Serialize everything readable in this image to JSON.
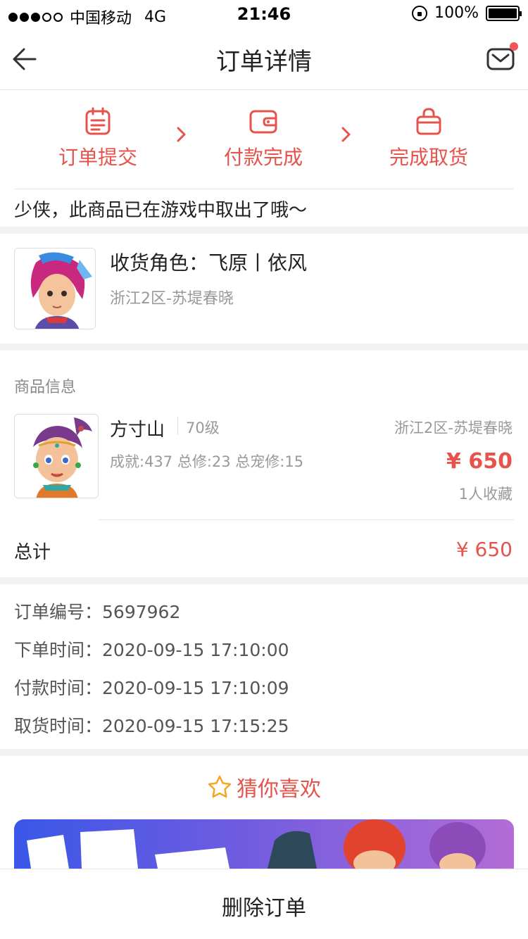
{
  "status_bar": {
    "carrier": "中国移动",
    "network": "4G",
    "time": "21:46",
    "battery": "100%"
  },
  "nav": {
    "title": "订单详情",
    "back_icon": "arrow-left-icon",
    "message_icon": "mail-icon"
  },
  "progress": {
    "steps": [
      {
        "label": "订单提交",
        "icon": "clipboard-icon"
      },
      {
        "label": "付款完成",
        "icon": "wallet-icon"
      },
      {
        "label": "完成取货",
        "icon": "bag-icon"
      }
    ],
    "message": "少侠，此商品已在游戏中取出了哦～"
  },
  "receiver": {
    "role": "收货角色：飞原丨依风",
    "server": "浙江2区-苏堤春晓"
  },
  "goods": {
    "section_title": "商品信息",
    "name": "方寸山",
    "level": "70级",
    "stats": "成就:437 总修:23 总宠修:15",
    "server": "浙江2区-苏堤春晓",
    "price": "¥ 650",
    "favorites": "1人收藏",
    "total_label": "总计",
    "total_value": "¥ 650"
  },
  "order_info": [
    {
      "label": "订单编号：",
      "value": "5697962"
    },
    {
      "label": "下单时间：",
      "value": "2020-09-15 17:10:00"
    },
    {
      "label": "付款时间：",
      "value": "2020-09-15 17:10:09"
    },
    {
      "label": "取货时间：",
      "value": "2020-09-15 17:15:25"
    }
  ],
  "guess": {
    "title": "猜你喜欢",
    "icon": "star-icon"
  },
  "bottom": {
    "delete_label": "删除订单"
  },
  "colors": {
    "accent": "#e5534b",
    "bg": "#f2f2f2"
  }
}
